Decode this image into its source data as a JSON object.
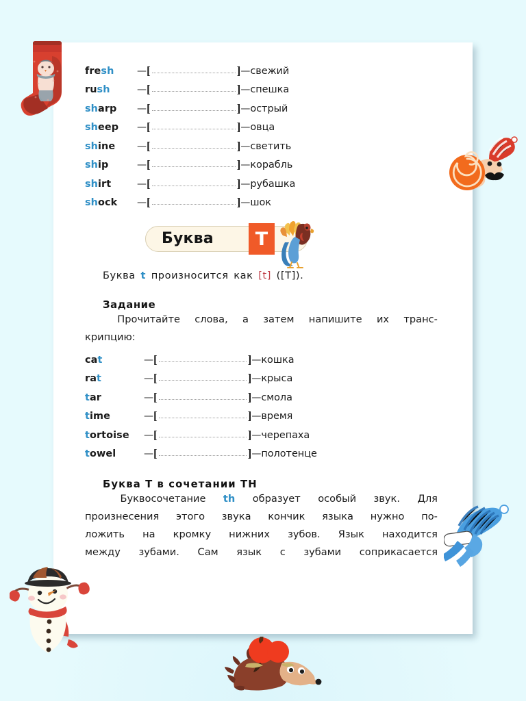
{
  "page": {
    "background_color": "#e2f8fb",
    "sheet_color": "#ffffff",
    "accent_blue": "#2f8fc6",
    "accent_red": "#c2414b",
    "accent_orange": "#f05a28",
    "banner_bg": "#fdf6e6"
  },
  "sh_word_list": {
    "rows": [
      {
        "pre": "fre",
        "hl": "sh",
        "post": "",
        "dash": "—",
        "dash2": "—",
        "ru": "свежий"
      },
      {
        "pre": "ru",
        "hl": "sh",
        "post": "",
        "dash": "—",
        "dash2": "—",
        "ru": "спешка"
      },
      {
        "pre": "",
        "hl": "sh",
        "post": "arp",
        "dash": "—",
        "dash2": "—",
        "ru": "острый"
      },
      {
        "pre": "",
        "hl": "sh",
        "post": "eep",
        "dash": "—",
        "dash2": "—",
        "ru": "овца"
      },
      {
        "pre": "",
        "hl": "sh",
        "post": "ine",
        "dash": "—",
        "dash2": "—",
        "ru": "светить"
      },
      {
        "pre": "",
        "hl": "sh",
        "post": "ip",
        "dash": "—",
        "dash2": "—",
        "ru": "корабль"
      },
      {
        "pre": "",
        "hl": "sh",
        "post": "irt",
        "dash": "—",
        "dash2": "—",
        "ru": "рубашка"
      },
      {
        "pre": "",
        "hl": "sh",
        "post": "ock",
        "dash": "—",
        "dash2": "—",
        "ru": "шок"
      }
    ],
    "bracket_open": "[",
    "bracket_close": "]"
  },
  "banner": {
    "text": "Буква",
    "letter": "T",
    "icon": "turkey-illustration"
  },
  "pronunciation": {
    "before": "Буква",
    "letter": "t",
    "middle": "произносится   как",
    "sound": "[t]",
    "after": "([Т])."
  },
  "task": {
    "heading": "Задание",
    "line1_words": [
      "Прочитайте",
      "слова,",
      "а",
      "затем",
      "напишите",
      "их",
      "транс-"
    ],
    "line2": "крипцию:"
  },
  "t_word_list": {
    "rows": [
      {
        "pre": "ca",
        "hl": "t",
        "post": "",
        "dash": "—",
        "dash2": "—",
        "ru": "кошка"
      },
      {
        "pre": "ra",
        "hl": "t",
        "post": "",
        "dash": "—",
        "dash2": "—",
        "ru": "крыса"
      },
      {
        "pre": "",
        "hl": "t",
        "post": "ar",
        "dash": "—",
        "dash2": "—",
        "ru": "смола"
      },
      {
        "pre": "",
        "hl": "t",
        "post": "ime",
        "dash": "—",
        "dash2": "—",
        "ru": "время"
      },
      {
        "pre": "",
        "hl": "t",
        "post": "ortoise",
        "dash": "—",
        "dash2": "—",
        "ru": "черепаха"
      },
      {
        "pre": "",
        "hl": "t",
        "post": "owel",
        "dash": "—",
        "dash2": "—",
        "ru": "полотенце"
      }
    ],
    "bracket_open": "[",
    "bracket_close": "]"
  },
  "th_section": {
    "heading": "Буква T в сочетании TH",
    "line1_a": "Буквосочетание",
    "line1_hl": "th",
    "line1_words": [
      "образует",
      "особый",
      "звук.",
      "Для"
    ],
    "line2_words": [
      "произнесения",
      "этого",
      "звука",
      "кончик",
      "языка",
      "нужно",
      "по-"
    ],
    "line3_words": [
      "ложить",
      "на",
      "кромку",
      "нижних",
      "зубов.",
      "Язык",
      "находится"
    ],
    "line4_words": [
      "между",
      "зубами.",
      "Сам",
      "язык",
      "с",
      "зубами",
      "соприкасается"
    ]
  },
  "decorations": [
    {
      "name": "christmas-sock-illustration",
      "description": "red knitted sock with snowman"
    },
    {
      "name": "snail-illustration",
      "description": "snail with orange spiral shell, striped hat, mustache"
    },
    {
      "name": "winter-hat-illustration",
      "description": "blue striped winter hat with scarf"
    },
    {
      "name": "snowman-illustration",
      "description": "snowman with black hat and red scarf"
    },
    {
      "name": "hedgehog-illustration",
      "description": "hedgehog carrying red apples"
    }
  ]
}
